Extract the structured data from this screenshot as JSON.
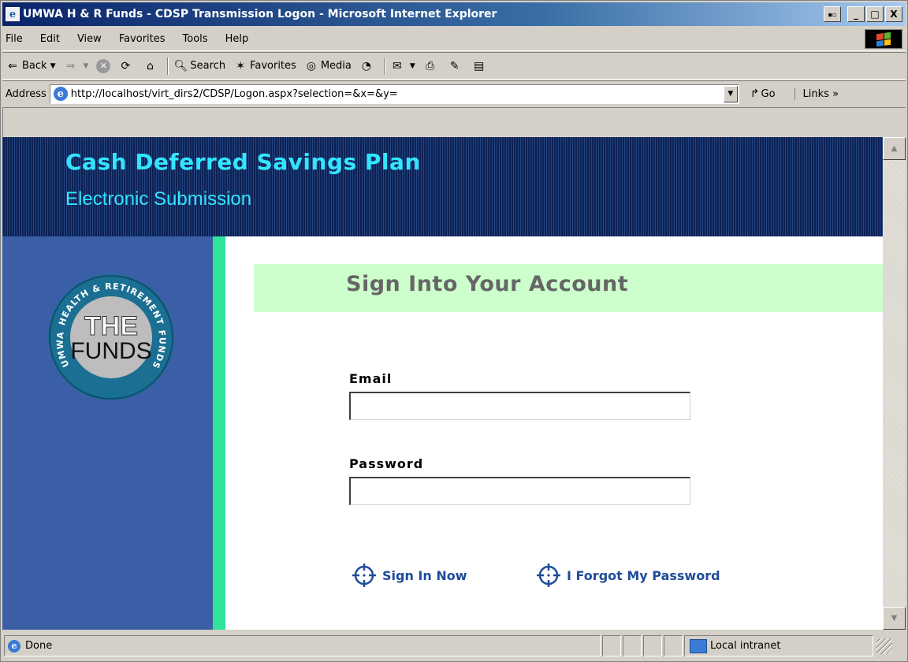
{
  "window": {
    "title": "UMWA H & R Funds - CDSP Transmission Logon - Microsoft Internet Explorer",
    "buttons": [
      "_",
      "□",
      "X"
    ]
  },
  "menu": [
    "File",
    "Edit",
    "View",
    "Favorites",
    "Tools",
    "Help"
  ],
  "toolbar": {
    "back": "Back",
    "search": "Search",
    "favorites": "Favorites",
    "media": "Media"
  },
  "address": {
    "label": "Address",
    "url": "http://localhost/virt_dirs2/CDSP/Logon.aspx?selection=&x=&y=",
    "go": "Go",
    "links": "Links »"
  },
  "page": {
    "header_title": "Cash Deferred Savings Plan",
    "header_subtitle": "Electronic Submission",
    "logo": {
      "ring_text_top": "HEALTH & RETIREMENT",
      "ring_left": "UMWA",
      "ring_right": "FUNDS",
      "center_top": "THE",
      "center_bottom": "FUNDS"
    },
    "signin_title": "Sign Into Your Account",
    "email_label": "Email",
    "email_value": "",
    "password_label": "Password",
    "password_value": "",
    "sign_in_label": "Sign In Now",
    "forgot_label": "I Forgot My Password",
    "colors": {
      "header_text": "#33e5ff",
      "sidebar": "#3a5fa6",
      "sidebar_stripe": "#2fe39a",
      "signin_band": "#ccffcc",
      "action_text": "#1f4c9a"
    }
  },
  "status": {
    "text": "Done",
    "zone": "Local intranet"
  }
}
